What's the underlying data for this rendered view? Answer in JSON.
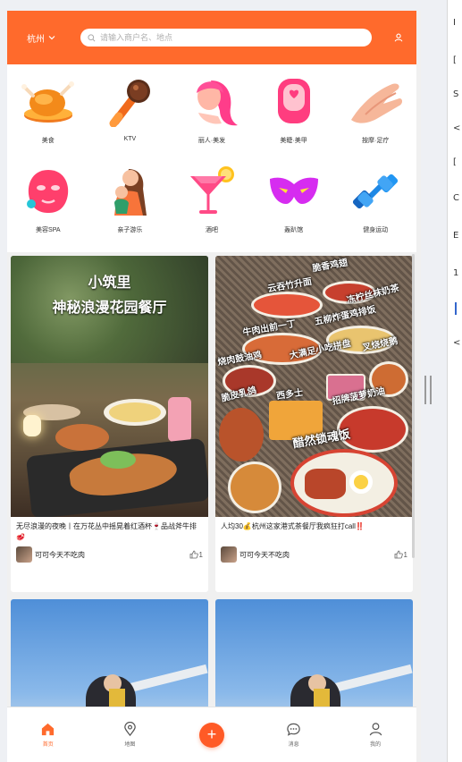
{
  "header": {
    "city": "杭州",
    "search_placeholder": "请输入商户名、地点"
  },
  "categories": [
    {
      "label": "美食",
      "icon": "roast-chicken-icon"
    },
    {
      "label": "KTV",
      "icon": "microphone-icon"
    },
    {
      "label": "丽人·美发",
      "icon": "hair-salon-icon"
    },
    {
      "label": "美睫·美甲",
      "icon": "nail-icon"
    },
    {
      "label": "按摩·足疗",
      "icon": "massage-hand-icon"
    },
    {
      "label": "美容SPA",
      "icon": "face-mask-icon"
    },
    {
      "label": "亲子游乐",
      "icon": "parent-child-icon"
    },
    {
      "label": "酒吧",
      "icon": "cocktail-icon"
    },
    {
      "label": "轰趴馆",
      "icon": "party-mask-icon"
    },
    {
      "label": "健身运动",
      "icon": "dumbbell-icon"
    }
  ],
  "feed": [
    {
      "image_title_line1": "小筑里",
      "image_title_line2": "神秘浪漫花园餐厅",
      "title": "无尽浪漫的夜晚丨在万花丛中摇晃着红酒杯🍷品战斧牛排🥩",
      "author": "可可今天不吃肉",
      "likes": "1"
    },
    {
      "image_tags": [
        "脆香鸡翅",
        "云吞竹升面",
        "冻柠丝袜奶茶",
        "牛肉出前一丁",
        "五柳炸蛋鸡排饭",
        "烧肉鼓油鸡",
        "大满足小吃拼盘",
        "叉烧烧鹅",
        "脆皮乳鸽",
        "西多士",
        "招牌菠萝奶油",
        "醋然锁魂饭"
      ],
      "title": "人均30💰杭州这家港式茶餐厅我疯狂打call‼️",
      "author": "可可今天不吃肉",
      "likes": "1"
    }
  ],
  "tabbar": [
    {
      "label": "首页",
      "icon": "home-icon",
      "active": true
    },
    {
      "label": "地图",
      "icon": "map-pin-icon",
      "active": false
    },
    {
      "label": "",
      "icon": "plus-icon",
      "active": false
    },
    {
      "label": "消息",
      "icon": "chat-bubble-icon",
      "active": false
    },
    {
      "label": "我的",
      "icon": "user-icon",
      "active": false
    }
  ],
  "side_glyphs": [
    "I",
    "[",
    "S",
    "<",
    "[",
    "C",
    "E",
    "1",
    "<"
  ],
  "colors": {
    "brand": "#ff6a2c",
    "plus": "#ff5a26"
  }
}
